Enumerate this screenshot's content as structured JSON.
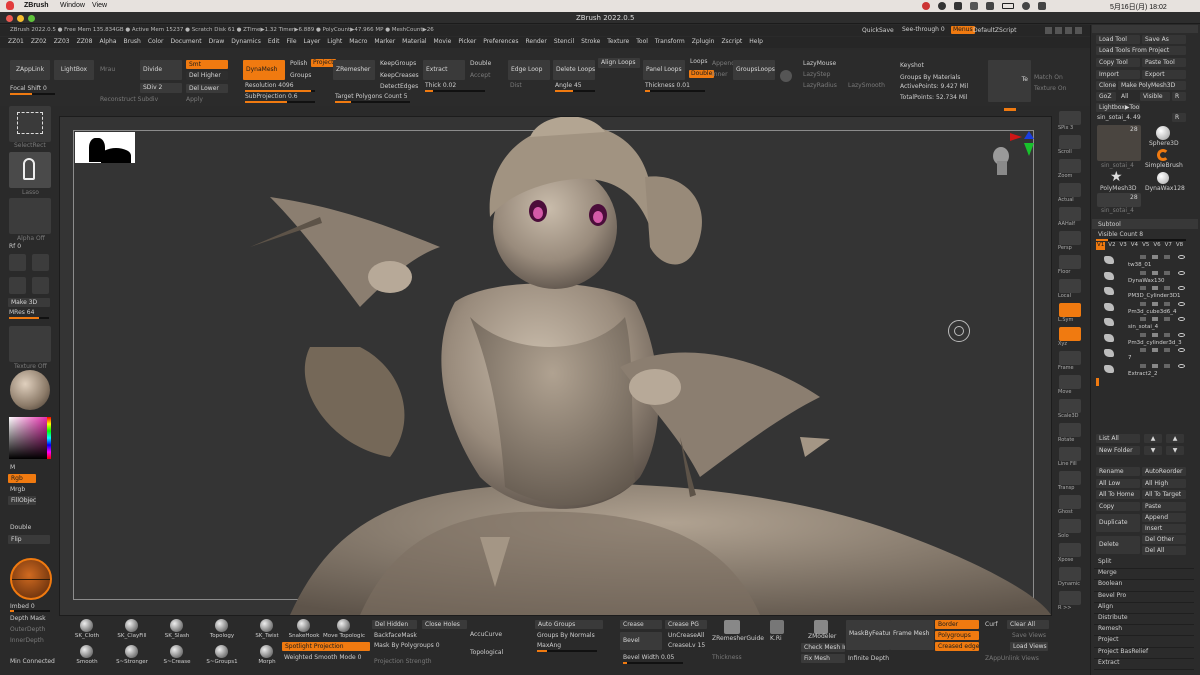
{
  "mac_menu": {
    "app": "ZBrush",
    "items": [
      "Window",
      "View"
    ],
    "datetime": "5月16日(月) 18:02"
  },
  "window_title": "ZBrush 2022.0.5",
  "info_bar": {
    "text": "ZBrush 2022.0.5  ● Free Mem 135.834GB ● Active Mem 15237 ● Scratch Disk 61 ● ZTime▶1.32 Timer▶6.889 ● PolyCount▶47.966 MP ● MeshCount▶26",
    "quicksave": "QuickSave",
    "see_through": "See-through  0",
    "menus_btn": "Menus",
    "default_zscript": "DefaultZScript"
  },
  "menu": [
    "ZZ01",
    "ZZ02",
    "ZZ03",
    "ZZ08",
    "Alpha",
    "Brush",
    "Color",
    "Document",
    "Draw",
    "Dynamics",
    "Edit",
    "File",
    "Layer",
    "Light",
    "Macro",
    "Marker",
    "Material",
    "Movie",
    "Picker",
    "Preferences",
    "Render",
    "Stencil",
    "Stroke",
    "Texture",
    "Tool",
    "Transform",
    "Zplugin",
    "Zscript",
    "Help"
  ],
  "top_shelf": {
    "zapplink": "ZAppLink",
    "lightbox": "LightBox",
    "mrau": "Mrau",
    "focal_shift": "Focal Shift 0",
    "divide": "Divide",
    "smt": "Smt",
    "del_higher": "Del Higher",
    "sdiv": "SDiv 2",
    "del_lower": "Del Lower",
    "reconstruct": "Reconstruct Subdiv",
    "apply": "Apply",
    "dynamesh": "DynaMesh",
    "polish": "Polish",
    "project": "Project",
    "groups": "Groups",
    "resolution": "Resolution 4096",
    "subprojection": "SubProjection 0.6",
    "zremesher": "ZRemesher",
    "keepgroups": "KeepGroups",
    "keepcreases": "KeepCreases",
    "detectedges": "DetectEdges",
    "target_polygons": "Target Polygons Count 5",
    "extract": "Extract",
    "double": "Double",
    "accept": "Accept",
    "thick": "Thick 0.02",
    "edge_loop": "Edge Loop",
    "delete_loops": "Delete Loops",
    "align_loops": "Align Loops",
    "dist": "Dist",
    "angle": "Angle 45",
    "panel_loops": "Panel Loops",
    "loops": "Loops",
    "append": "Append",
    "double2": "Double",
    "inner": "Inner",
    "thickness": "Thickness 0.01",
    "groupsloops": "GroupsLoops",
    "lazymouse": "LazyMouse",
    "lazystep": "LazyStep",
    "lazyradius": "LazyRadius",
    "lazysmooth": "LazySmooth",
    "keyshot": "Keyshot",
    "groups_by_materials": "Groups By Materials",
    "active_points": "ActivePoints: 9.427 Mil",
    "total_points": "TotalPoints: 52.734 Mil",
    "te": "Te",
    "match_on": "Match On",
    "texture_on": "Texture On"
  },
  "left_shelf": {
    "selectrect": "SelectRect",
    "lasso": "Lasso",
    "alpha_off": "Alpha Off",
    "rf": "Rf 0",
    "make3d": "Make 3D",
    "mres": "MRes 64",
    "texture_off": "Texture Off",
    "m": "M",
    "rgb": "Rgb",
    "mrgb": "Mrgb",
    "fillobject": "FillObject",
    "double": "Double",
    "flip": "Flip",
    "imbed": "Imbed 0",
    "depth_mask": "Depth Mask",
    "outer_depth": "OuterDepth",
    "inner_depth": "InnerDepth",
    "min_connected": "Min Connected"
  },
  "right_shelf": [
    "SPix 3",
    "Scroll",
    "Zoom",
    "Actual",
    "AAHalf",
    "Persp",
    "Floor",
    "Local",
    "L.Sym",
    "Xyz",
    "Frame",
    "Move",
    "Scale3D",
    "Rotate",
    "Line Fill",
    "Transp",
    "Ghost",
    "Solo",
    "Xpose",
    "Dynamic",
    "R >>"
  ],
  "tool_panel": {
    "load_tool": "Load Tool",
    "save_as": "Save As",
    "load_tools_from_project": "Load Tools From Project",
    "copy_tool": "Copy Tool",
    "paste_tool": "Paste Tool",
    "import": "Import",
    "export": "Export",
    "clone": "Clone",
    "make_polymesh": "Make PolyMesh3D",
    "goz": "GoZ",
    "all": "All",
    "visible": "Visible",
    "r": "R",
    "lightbox_tools": "Lightbox▶Tools",
    "tool_name": "sin_sotai_4.",
    "tool_num": "49",
    "r2": "R",
    "thumbs": [
      {
        "label": "sin_sotai_4",
        "count": "28"
      },
      {
        "label": "Sphere3D"
      },
      {
        "label": "SimpleBrush"
      },
      {
        "label": "PolyMesh3D"
      },
      {
        "label": "DynaWax128"
      },
      {
        "label": "sin_sotai_4",
        "count": "28"
      }
    ]
  },
  "subtool": {
    "header": "Subtool",
    "visible_count": "Visible Count 8",
    "versions": [
      "V1",
      "V2",
      "V3",
      "V4",
      "V5",
      "V6",
      "V7",
      "V8"
    ],
    "items": [
      "tw38_01",
      "DynaWax130",
      "PM3D_Cylinder3D1",
      "Pm3d_cube3d6_4",
      "sin_sotai_4",
      "Pm3d_cylinder3d_3",
      "7",
      "Extract2_2"
    ],
    "list_all": "List All",
    "new_folder": "New Folder",
    "rename": "Rename",
    "autoreorder": "AutoReorder",
    "all_low": "All Low",
    "all_high": "All High",
    "all_to_home": "All To Home",
    "all_to_target": "All To Target",
    "copy": "Copy",
    "paste": "Paste",
    "duplicate": "Duplicate",
    "append": "Append",
    "insert": "Insert",
    "delete": "Delete",
    "del_other": "Del Other",
    "del_all": "Del All",
    "more": [
      "Split",
      "Merge",
      "Boolean",
      "Bevel Pro",
      "Align",
      "Distribute",
      "Remesh",
      "Project",
      "Project BasRelief",
      "Extract"
    ]
  },
  "bottom_shelf": {
    "brushes": [
      "SK_Cloth",
      "SK_ClayFill",
      "SK_Slash",
      "Topology",
      "SK_Twist",
      "SnakeHook",
      "Move Topologic",
      "Smooth",
      "S~Stronger",
      "S~Crease",
      "S~Groups1",
      "Morph"
    ],
    "del_hidden": "Del Hidden",
    "close_holes": "Close Holes",
    "backfacemask": "BackfaceMask",
    "mask_by_polygroups": "Mask By Polygroups 0",
    "spotlight_projection": "Spotlight Projection",
    "weighted_smooth": "Weighted Smooth Mode 0",
    "projection_strength": "Projection Strength",
    "accucurve": "AccuCurve",
    "topological": "Topological",
    "auto_groups": "Auto Groups",
    "groups_by_normals": "Groups By Normals",
    "maxangle": "MaxAng",
    "crease": "Crease",
    "crease_pg": "Crease PG",
    "bevel": "Bevel",
    "uncreaseall": "UnCreaseAll",
    "creaselv": "CreaseLv 15",
    "bevel_width": "Bevel Width 0.05",
    "thickness": "Thickness",
    "zremesher_guide": "ZRemesherGuide",
    "kri": "K.Ri",
    "zmodeler": "ZModeler",
    "check_mesh": "Check Mesh Int",
    "fix_mesh": "Fix Mesh",
    "maskbyfeature": "MaskByFeature",
    "infinite_depth": "Infinite Depth",
    "frame_mesh": "Frame Mesh",
    "border": "Border",
    "polygroups": "Polygroups",
    "creased_edges": "Creased edges",
    "curf": "Curf",
    "clear_all": "Clear All",
    "save_views": "Save Views",
    "load_views": "Load Views",
    "zappunlink_views": "ZAppUnlink Views"
  },
  "colors": {
    "accent": "#f07a10",
    "panel": "#2a2a2a",
    "canvas": "#343434",
    "model": "#a4978a"
  }
}
